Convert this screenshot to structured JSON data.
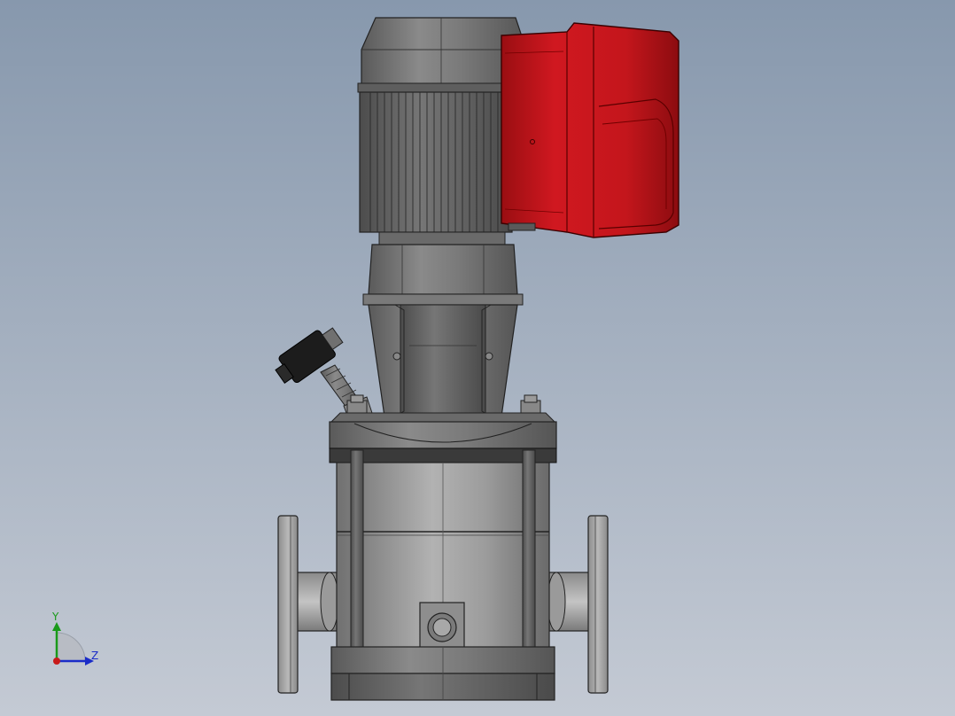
{
  "viewport": {
    "background_top": "#8798ad",
    "background_bottom": "#c4cad4"
  },
  "colors": {
    "metal_dark": "#5c5c5c",
    "metal_mid": "#7b7b7b",
    "metal_light": "#9a9a9a",
    "motor_box_red": "#c8141a",
    "motor_box_red_dark": "#8f0c10",
    "connector_black": "#1c1c1c",
    "axis_y": "#1a9a1a",
    "axis_z": "#1a2cc8",
    "axis_x": "#c81a1a"
  },
  "triad": {
    "y_label": "Y",
    "z_label": "Z"
  },
  "model": {
    "parts": [
      "motor-fan-cover",
      "motor-body",
      "terminal-box",
      "motor-stool",
      "coupling-guard",
      "pressure-sensor",
      "pump-head",
      "pump-sleeve",
      "tie-bolts",
      "inlet-flange",
      "outlet-flange",
      "pump-base",
      "drain-plug"
    ]
  }
}
